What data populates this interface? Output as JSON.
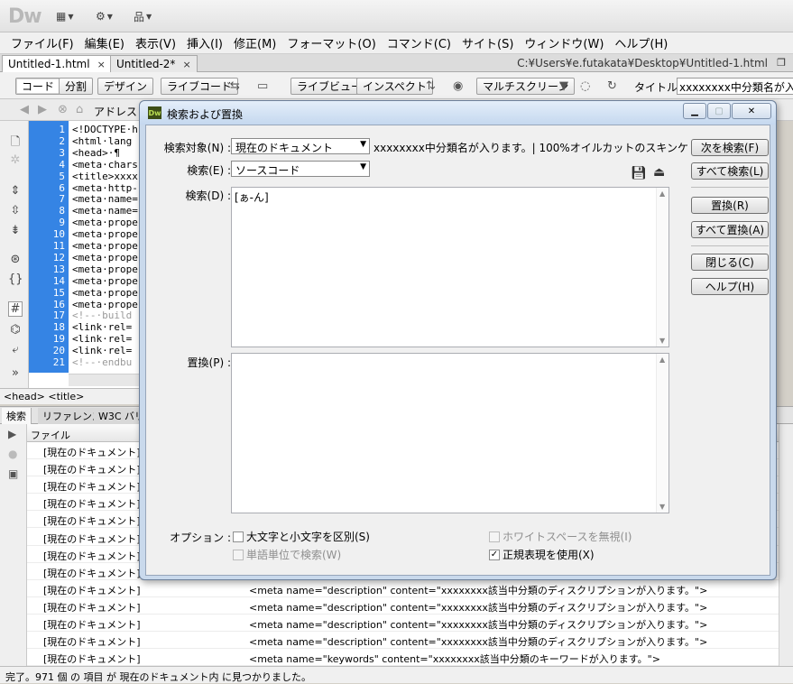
{
  "app": {
    "logo": "Dw",
    "toolbar_icons": [
      "layout-icon",
      "gear-icon",
      "sitemap-icon"
    ]
  },
  "menu": [
    "ファイル(F)",
    "編集(E)",
    "表示(V)",
    "挿入(I)",
    "修正(M)",
    "フォーマット(O)",
    "コマンド(C)",
    "サイト(S)",
    "ウィンドウ(W)",
    "ヘルプ(H)"
  ],
  "doc_tabs": [
    {
      "label": "Untitled-1.html",
      "close": "×"
    },
    {
      "label": "Untitled-2*",
      "close": "×"
    }
  ],
  "doc_path": "C:¥Users¥e.futakata¥Desktop¥Untitled-1.html",
  "view_buttons": {
    "code": "コード",
    "split": "分割",
    "design": "デザイン",
    "live_code": "ライブコード",
    "live_view": "ライブビュー",
    "inspect": "インスペクト",
    "multiscreen": "マルチスクリーン"
  },
  "title_field": {
    "label": "タイトル :",
    "value": "xxxxxxxx中分類名が入り"
  },
  "address_label": "アドレス :",
  "code": {
    "line_numbers": [
      "1",
      "2",
      "3",
      "4",
      "5",
      "6",
      "7",
      "8",
      "9",
      "10",
      "11",
      "12",
      "13",
      "14",
      "15",
      "16",
      "17",
      "18",
      "19",
      "20",
      "21"
    ],
    "lines": [
      "<!DOCTYPE·h",
      "<html·lang",
      "<head>·¶",
      "<meta·chars",
      "<title>xxxx",
      "<meta·http-",
      "<meta·name=",
      "<meta·name=",
      "<meta·prope",
      "<meta·prope",
      "<meta·prope",
      "<meta·prope",
      "<meta·prope",
      "<meta·prope",
      "<meta·prope",
      "<meta·prope",
      "<!--·build",
      "<link·rel=",
      "<link·rel=",
      "<link·rel=",
      "<!--·endbu"
    ]
  },
  "tag_selector": "<head> <title>",
  "panel": {
    "tabs": [
      "検索",
      "リファレンス",
      "W3C バリ"
    ],
    "file_header": "ファイル",
    "rows": [
      {
        "file": "[現在のドキュメント]",
        "match": ""
      },
      {
        "file": "[現在のドキュメント]",
        "match": ""
      },
      {
        "file": "[現在のドキュメント]",
        "match": ""
      },
      {
        "file": "[現在のドキュメント]",
        "match": ""
      },
      {
        "file": "[現在のドキュメント]",
        "match": ""
      },
      {
        "file": "[現在のドキュメント]",
        "match": ""
      },
      {
        "file": "[現在のドキュメント]",
        "match": ""
      },
      {
        "file": "[現在のドキュメント]",
        "match": ""
      },
      {
        "file": "[現在のドキュメント]",
        "match": "<meta  name=\"description\"  content=\"xxxxxxxx該当中分類のディスクリプションが入ります。\">"
      },
      {
        "file": "[現在のドキュメント]",
        "match": "<meta  name=\"description\"  content=\"xxxxxxxx該当中分類のディスクリプションが入ります。\">"
      },
      {
        "file": "[現在のドキュメント]",
        "match": "<meta  name=\"description\"  content=\"xxxxxxxx該当中分類のディスクリプションが入ります。\">"
      },
      {
        "file": "[現在のドキュメント]",
        "match": "<meta  name=\"description\"  content=\"xxxxxxxx該当中分類のディスクリプションが入ります。\">"
      },
      {
        "file": "[現在のドキュメント]",
        "match": "<meta  name=\"keywords\"  content=\"xxxxxxxx該当中分類のキーワードが入ります。\">"
      }
    ]
  },
  "status": "完了。971 個 の 項目 が 現在のドキュメント内 に見つかりました。",
  "dialog": {
    "title": "検索および置換",
    "logo": "Dw",
    "search_target": {
      "label": "検索対象(N) :",
      "value": "現在のドキュメント",
      "doc_name": "xxxxxxxx中分類名が入ります。| 100%オイルカットのスキンケ"
    },
    "search_type": {
      "label": "検索(E) :",
      "value": "ソースコード"
    },
    "search_label": "検索(D) :",
    "search_text": "[ぁ-ん]",
    "replace_label": "置換(P) :",
    "replace_text": "",
    "options_label": "オプション :",
    "options": {
      "match_case": "大文字と小文字を区別(S)",
      "whole_word": "単語単位で検索(W)",
      "ignore_whitespace": "ホワイトスペースを無視(I)",
      "regex": "正規表現を使用(X)"
    },
    "checked_mark": "✓",
    "buttons": {
      "find_next": "次を検索(F)",
      "find_all": "すべて検索(L)",
      "replace": "置換(R)",
      "replace_all": "すべて置換(A)",
      "close": "閉じる(C)",
      "help": "ヘルプ(H)"
    }
  }
}
